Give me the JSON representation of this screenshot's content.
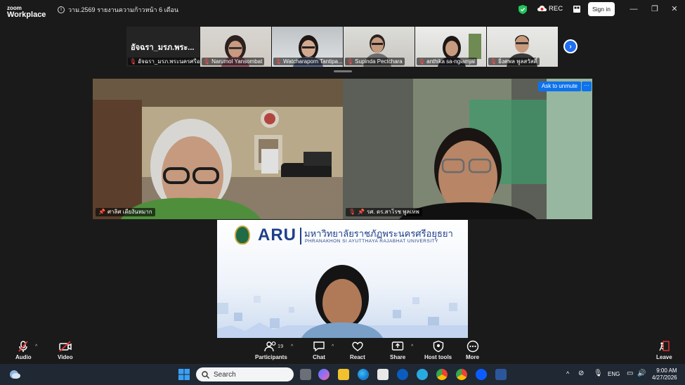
{
  "titlebar": {
    "logo_top": "zoom",
    "logo_bottom": "Workplace",
    "meeting_title": "วาม.2569 รายงานความก้าวหน้า 6 เดือน",
    "rec_label": "REC",
    "signin_label": "Sign in"
  },
  "filmstrip": {
    "first_name_big": "อัจฉรา_มรภ.พระ...",
    "participants": [
      {
        "name": "อัจฉรา_มรภ.พระนครศรีอยุ..."
      },
      {
        "name": "Narumol Yansombat"
      },
      {
        "name": "Watcharaporn Tantipa..."
      },
      {
        "name": "Supinda Pectchara"
      },
      {
        "name": "anthika sa-ngiamjai"
      },
      {
        "name": "ยิ่งศพล พูลสวัสดิ์"
      }
    ]
  },
  "main": {
    "left_name": "ศาลิศ เดียงันหมาก",
    "right_name": "รศ. ดร.สาโรช พูลเทพ",
    "ask_unmute": "Ask to unmute",
    "more_dots": "···",
    "bottom": {
      "brand": "ARU",
      "thai_name": "มหาวิทยาลัยราชภัฏพระนครศรีอยุธยา",
      "eng_name": "PHRANAKHON SI AYUTTHAYA RAJABHAT UNIVERSITY"
    }
  },
  "toolbar": {
    "audio": "Audio",
    "video": "Video",
    "participants": "Participants",
    "participants_count": "19",
    "chat": "Chat",
    "react": "React",
    "share": "Share",
    "host_tools": "Host tools",
    "more": "More",
    "leave": "Leave"
  },
  "taskbar": {
    "search_placeholder": "Search",
    "lang": "ENG",
    "time": "9:00 AM",
    "date": "4/27/2026"
  }
}
